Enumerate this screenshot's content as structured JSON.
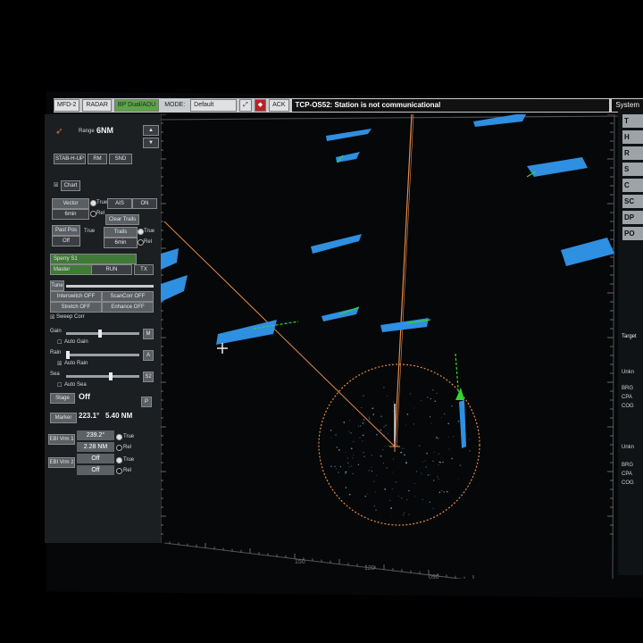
{
  "topbar": {
    "mfd": "MFD-2",
    "mode_source": "RADAR",
    "status_green": "BP Dual/ADU",
    "mode_label": "MODE:",
    "mode_value": "Default",
    "ack": "ACK",
    "alarm": "TCP-OS52: Station is not communicational",
    "system": "System"
  },
  "left": {
    "range_label": "Range",
    "range_value": "6NM",
    "orient": "STAB-H-UP",
    "mode2": "RM",
    "mode3": "SND",
    "chart_label": "Chart",
    "vector_label": "Vector",
    "vector_value": "6min",
    "true_label": "True",
    "rel_label": "Rel",
    "ais_label": "AIS",
    "on_label": "ON",
    "clear_trails": "Clear Trails",
    "past_pos": "Past Pos",
    "past_pos_value": "Off",
    "trails": "Trails",
    "trails_value": "6min",
    "true2": "True",
    "rel2": "Rel",
    "sperry": "Sperry S1",
    "master": "Master",
    "run": "RUN",
    "tx": "TX",
    "tune": "Tune",
    "interswitch": "Interswitch OFF",
    "scan_corr": "ScanCorr OFF",
    "stretch": "Stretch OFF",
    "enhance": "Enhance OFF",
    "sweep_corr": "Sweep Corr",
    "gain_label": "Gain",
    "auto_gain": "Auto Gain",
    "rain_label": "Rain",
    "auto_rain": "Auto Rain",
    "sea_label": "Sea",
    "auto_sea": "Auto Sea",
    "stage_label": "Stage",
    "stage_value": "Off",
    "marker_label": "Marker",
    "marker_bearing": "223.1°",
    "marker_range": "5.40 NM",
    "ebl_vrm1": "EBI Vrm 1",
    "ebl1_bearing": "239.2°",
    "ebl1_range": "2.28 NM",
    "ebl_vrm2": "EBI Vrm 2",
    "ebl2_bearing": "Off",
    "ebl2_range": "Off",
    "true3": "True",
    "rel3": "Rel",
    "true4": "True",
    "rel4": "Rel"
  },
  "scale": {
    "s150": "150",
    "s120": "120",
    "s090": "090",
    "s060": "060"
  },
  "right": {
    "buttons": [
      "T",
      "H",
      "R",
      "S",
      "C",
      "SC",
      "DP",
      "PO"
    ],
    "target_label": "Target",
    "unk1": "Unkn",
    "brg1": "BRG",
    "cpa1": "CPA",
    "cog1": "COG",
    "unk2": "Unkn",
    "brg2": "BRG",
    "cpa2": "CPA",
    "cog2": "COG"
  },
  "colors": {
    "target_blue": "#2f8fe0",
    "vector_green": "#37d431",
    "ebl_orange": "#e88a4a"
  }
}
